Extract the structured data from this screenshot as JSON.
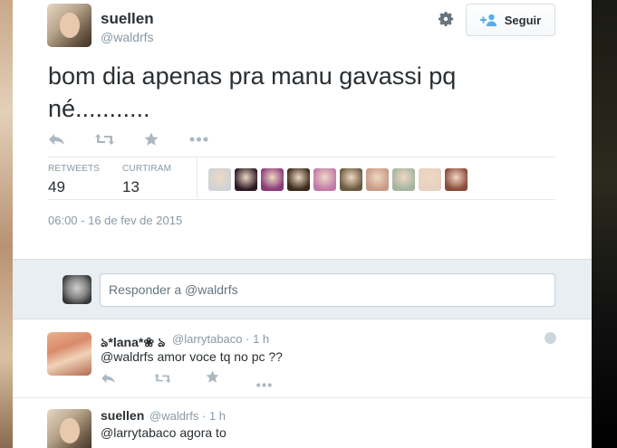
{
  "tweet": {
    "author_name": "suellen",
    "author_handle": "@waldrfs",
    "text_line1": "bom dia apenas pra manu gavassi pq",
    "text_line2": "né...........",
    "follow_label": "Seguir",
    "stats": {
      "retweets_label": "RETWEETS",
      "retweets_value": "49",
      "favorites_label": "CURTIRAM",
      "favorites_value": "13"
    },
    "favoriters": [
      {
        "name": "favoriter-avatar-1",
        "color": "#cfd3d6"
      },
      {
        "name": "favoriter-avatar-2",
        "color": "#2b1a26"
      },
      {
        "name": "favoriter-avatar-3",
        "color": "#8a3c7a"
      },
      {
        "name": "favoriter-avatar-4",
        "color": "#3b2a1c"
      },
      {
        "name": "favoriter-avatar-5",
        "color": "#c07aa8"
      },
      {
        "name": "favoriter-avatar-6",
        "color": "#6b5a40"
      },
      {
        "name": "favoriter-avatar-7",
        "color": "#c79a86"
      },
      {
        "name": "favoriter-avatar-8",
        "color": "#a6b5a0"
      },
      {
        "name": "favoriter-avatar-9",
        "color": "#e6d2c0"
      },
      {
        "name": "favoriter-avatar-10",
        "color": "#8a4a3a"
      }
    ],
    "timestamp": "06:00 - 16 de fev de 2015"
  },
  "reply_box": {
    "placeholder": "Responder a @waldrfs"
  },
  "replies": [
    {
      "name": "ঌ*lana*❀ ঌ",
      "handle": "@larrytabaco",
      "time": "· 1 h",
      "text": "@waldrfs amor voce tq no pc ??"
    },
    {
      "name": "suellen",
      "handle": "@waldrfs",
      "time": "· 1 h",
      "text": "@larrytabaco agora to"
    }
  ],
  "colors": {
    "icon_gray": "#aab8c2",
    "text_primary": "#292f33",
    "text_secondary": "#8899a6",
    "follow_icon": "#55acee"
  },
  "icons": [
    "gear-icon",
    "follow-person-icon",
    "reply-icon",
    "retweet-icon",
    "favorite-icon",
    "more-icon"
  ]
}
